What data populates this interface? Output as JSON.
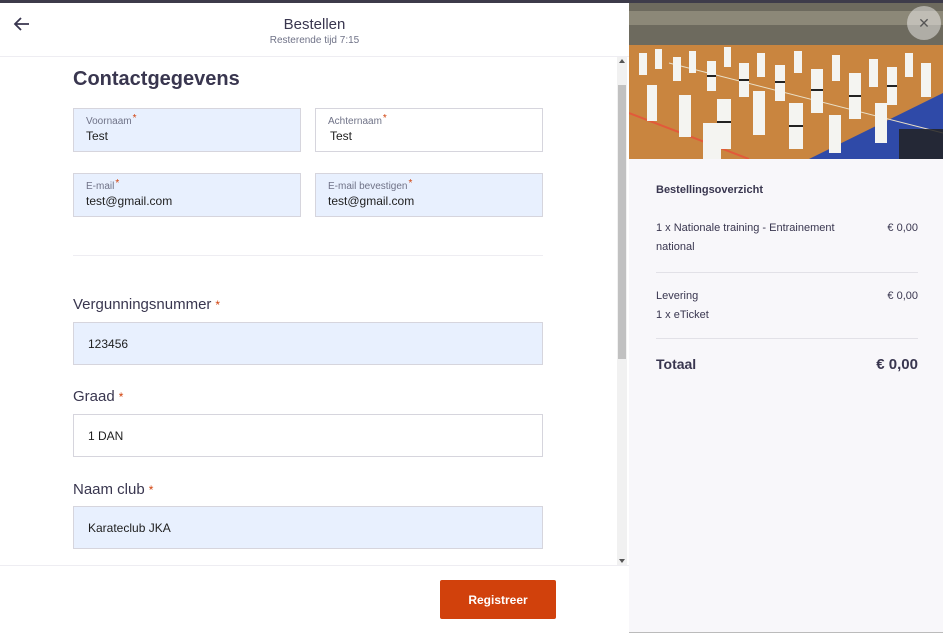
{
  "header": {
    "title": "Bestellen",
    "timer": "Resterende tijd 7:15"
  },
  "contact": {
    "section_title": "Contactgegevens",
    "first_name": {
      "label": "Voornaam",
      "value": "Test"
    },
    "last_name": {
      "label": "Achternaam",
      "value": "Test"
    },
    "email": {
      "label": "E-mail",
      "value": "test@gmail.com"
    },
    "email_confirm": {
      "label": "E-mail bevestigen",
      "value": "test@gmail.com"
    },
    "required_mark": "*"
  },
  "license": {
    "label": "Vergunningsnummer",
    "value": "123456"
  },
  "grade": {
    "label": "Graad",
    "value": "1 DAN"
  },
  "club": {
    "label": "Naam club",
    "value": "Karateclub JKA"
  },
  "footer": {
    "submit_label": "Registreer"
  },
  "summary": {
    "title": "Bestellingsoverzicht",
    "items": [
      {
        "name": "1 x Nationale training - Entrainement national",
        "price": "€ 0,00"
      },
      {
        "name": "Levering",
        "sub": "1 x eTicket",
        "price": "€ 0,00"
      }
    ],
    "total_label": "Totaal",
    "total_value": "€ 0,00"
  },
  "colors": {
    "accent": "#d1410c",
    "autofill": "#e8f0fe",
    "text": "#39364f"
  },
  "icons": {
    "back": "arrow-left-icon",
    "close": "close-icon"
  }
}
